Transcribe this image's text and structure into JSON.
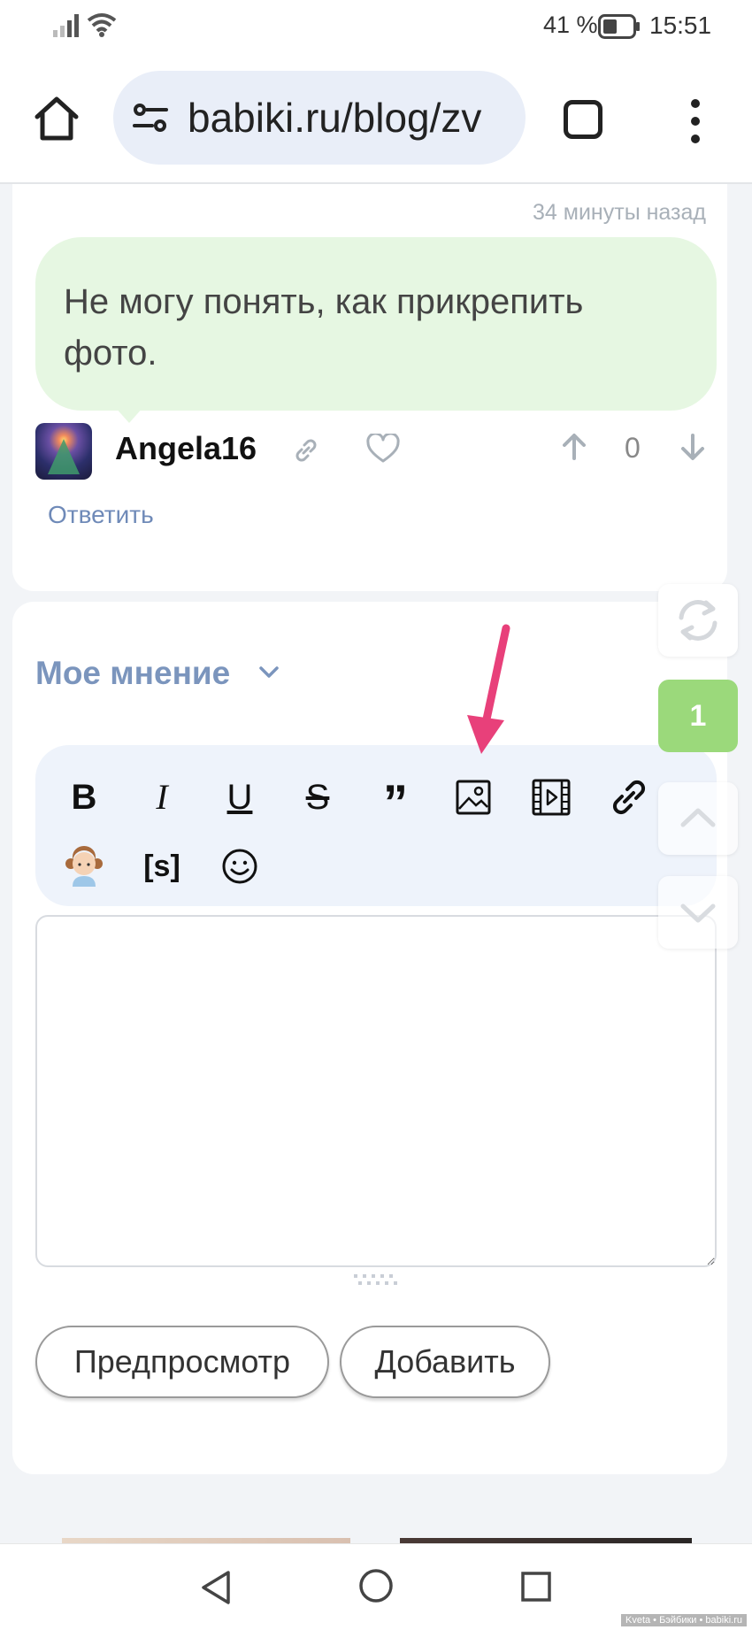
{
  "status_bar": {
    "battery_percent": "41 %",
    "time": "15:51"
  },
  "browser": {
    "url": "babiki.ru/blog/zv"
  },
  "comment": {
    "timestamp": "34 минуты назад",
    "text": "Не могу понять, как прикрепить фото.",
    "author": "Angela16",
    "vote_count": "0",
    "reply_label": "Ответить"
  },
  "side_controls": {
    "new_count": "1"
  },
  "editor": {
    "section_label": "Мое мнение",
    "toolbar": {
      "bold": "B",
      "italic": "I",
      "underline": "U",
      "strike": "S",
      "quote": "”",
      "spoiler": "[s]"
    },
    "textarea_value": "",
    "preview_label": "Предпросмотр",
    "add_label": "Добавить"
  },
  "footer": {
    "watermark": "Kveta • Бэйбики • babiki.ru"
  },
  "colors": {
    "accent_green": "#9bd97b",
    "bubble_green": "#e6f7e2",
    "link_blue": "#6f8ab8",
    "annotation_pink": "#e8407a"
  }
}
